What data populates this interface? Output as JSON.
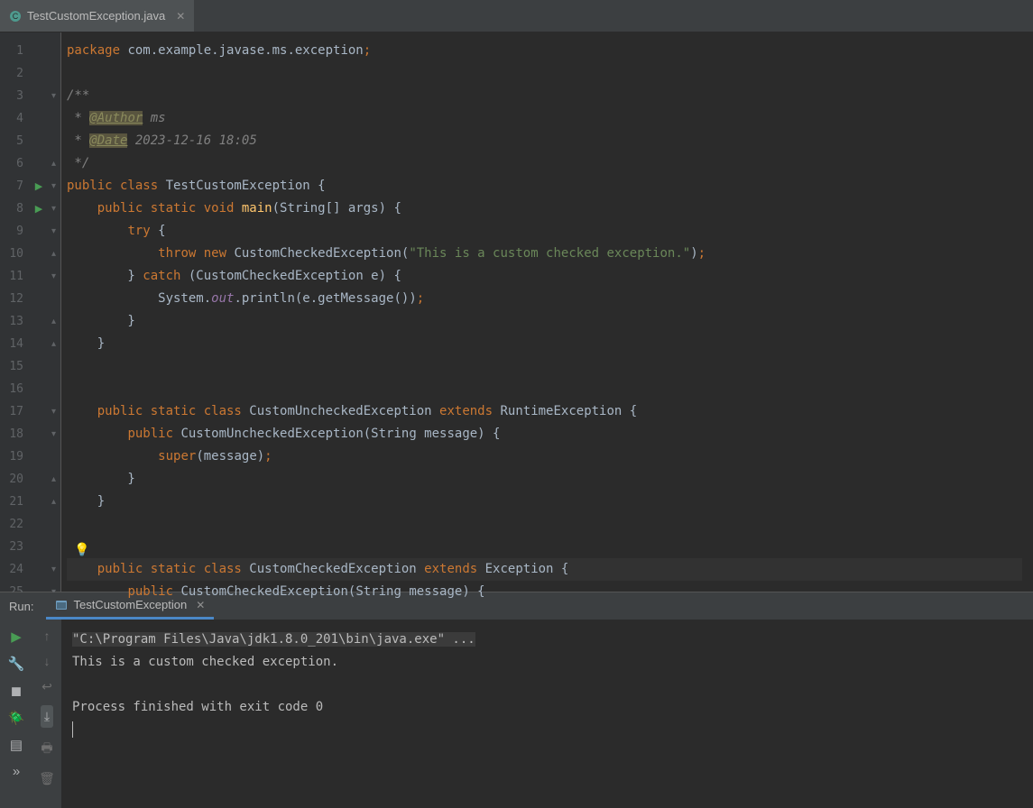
{
  "tab": {
    "filename": "TestCustomException.java"
  },
  "code": {
    "tokens": [
      [
        [
          "kw",
          "package"
        ],
        [
          "punct",
          " com.example.javase.ms.exception"
        ],
        [
          "semi",
          ";"
        ]
      ],
      [
        [
          "punct",
          ""
        ]
      ],
      [
        [
          "cm",
          "/**"
        ]
      ],
      [
        [
          "cm",
          " * "
        ],
        [
          "tag-hl",
          "@Author"
        ],
        [
          "cm",
          " ms"
        ]
      ],
      [
        [
          "cm",
          " * "
        ],
        [
          "tag-hl",
          "@Date"
        ],
        [
          "cm",
          " 2023-12-16 18:05"
        ]
      ],
      [
        [
          "cm",
          " */"
        ]
      ],
      [
        [
          "kw",
          "public class "
        ],
        [
          "cls",
          "TestCustomException"
        ],
        [
          "punct",
          " {"
        ]
      ],
      [
        [
          "punct",
          "    "
        ],
        [
          "kw",
          "public static void "
        ],
        [
          "method",
          "main"
        ],
        [
          "punct",
          "(String[] args) {"
        ]
      ],
      [
        [
          "punct",
          "        "
        ],
        [
          "kw",
          "try"
        ],
        [
          "punct",
          " {"
        ]
      ],
      [
        [
          "punct",
          "            "
        ],
        [
          "kw",
          "throw new "
        ],
        [
          "cls",
          "CustomCheckedException"
        ],
        [
          "punct",
          "("
        ],
        [
          "str",
          "\"This is a custom checked exception.\""
        ],
        [
          "punct",
          ")"
        ],
        [
          "semi",
          ";"
        ]
      ],
      [
        [
          "punct",
          "        } "
        ],
        [
          "kw",
          "catch"
        ],
        [
          "punct",
          " (CustomCheckedException e) {"
        ]
      ],
      [
        [
          "punct",
          "            System."
        ],
        [
          "field-it",
          "out"
        ],
        [
          "punct",
          ".println(e.getMessage())"
        ],
        [
          "semi",
          ";"
        ]
      ],
      [
        [
          "punct",
          "        }"
        ]
      ],
      [
        [
          "punct",
          "    }"
        ]
      ],
      [
        [
          "punct",
          ""
        ]
      ],
      [
        [
          "punct",
          ""
        ]
      ],
      [
        [
          "punct",
          "    "
        ],
        [
          "kw",
          "public static class "
        ],
        [
          "cls",
          "CustomUncheckedException"
        ],
        [
          "punct",
          " "
        ],
        [
          "kw",
          "extends"
        ],
        [
          "punct",
          " RuntimeException {"
        ]
      ],
      [
        [
          "punct",
          "        "
        ],
        [
          "kw",
          "public "
        ],
        [
          "cls",
          "CustomUncheckedException"
        ],
        [
          "punct",
          "(String message) {"
        ]
      ],
      [
        [
          "punct",
          "            "
        ],
        [
          "kw",
          "super"
        ],
        [
          "punct",
          "(message)"
        ],
        [
          "semi",
          ";"
        ]
      ],
      [
        [
          "punct",
          "        }"
        ]
      ],
      [
        [
          "punct",
          "    }"
        ]
      ],
      [
        [
          "punct",
          ""
        ]
      ],
      [
        [
          "punct",
          ""
        ]
      ],
      [
        [
          "punct",
          "    "
        ],
        [
          "kw",
          "public static class "
        ],
        [
          "cls",
          "CustomCheckedException"
        ],
        [
          "punct",
          " "
        ],
        [
          "kw",
          "extends"
        ],
        [
          "punct",
          " Exception {"
        ]
      ],
      [
        [
          "punct",
          "        "
        ],
        [
          "kw",
          "public "
        ],
        [
          "cls",
          "CustomCheckedException"
        ],
        [
          "punct",
          "(String message) {"
        ]
      ]
    ],
    "line_count": 25,
    "highlight_line": 24,
    "run_gutter_lines": [
      7,
      8
    ]
  },
  "run": {
    "label": "Run:",
    "tab_name": "TestCustomException",
    "console": {
      "cmd": "\"C:\\Program Files\\Java\\jdk1.8.0_201\\bin\\java.exe\" ...",
      "output": "This is a custom checked exception.",
      "exit": "Process finished with exit code 0"
    }
  }
}
